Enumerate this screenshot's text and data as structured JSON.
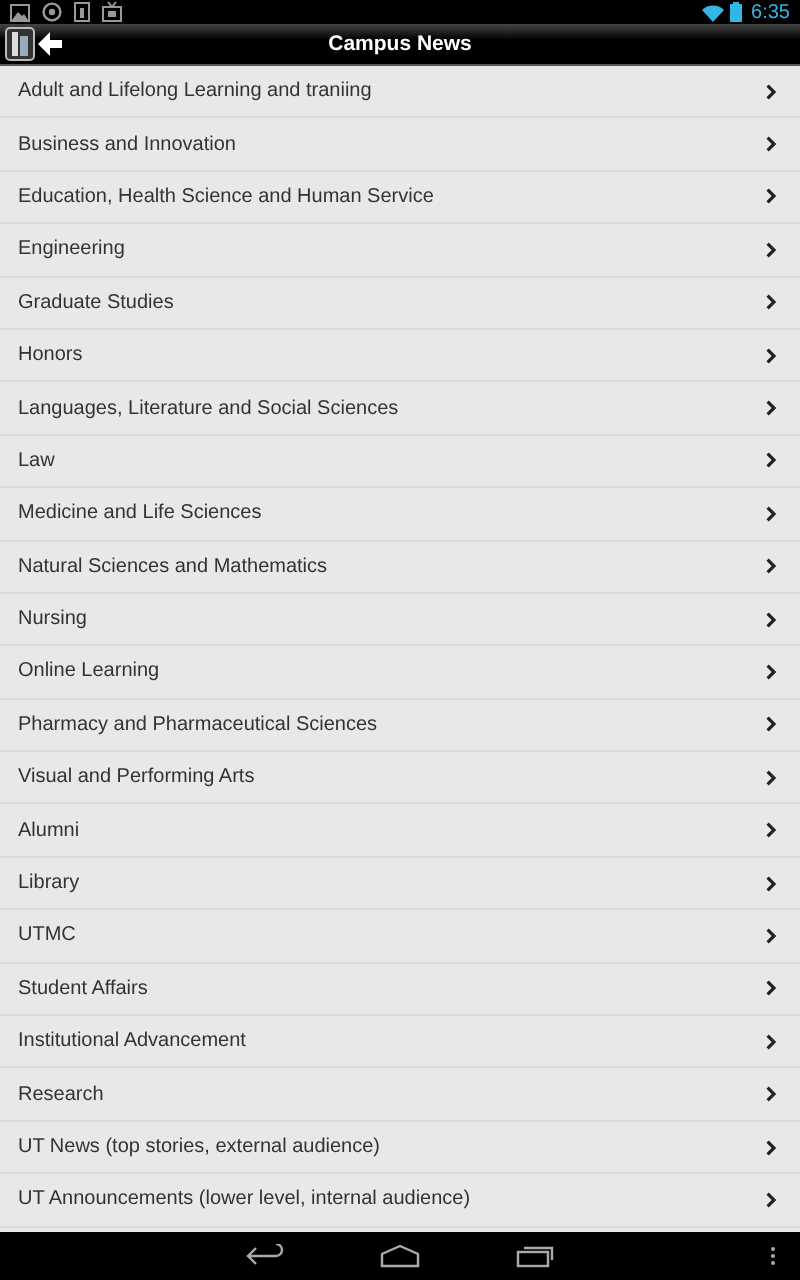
{
  "status_bar": {
    "time": "6:35"
  },
  "action_bar": {
    "title": "Campus News"
  },
  "items": [
    "Adult and Lifelong Learning and traniing",
    "Business and Innovation",
    "Education, Health Science and Human Service",
    "Engineering",
    "Graduate Studies",
    "Honors",
    "Languages, Literature and Social Sciences",
    "Law",
    "Medicine and Life Sciences",
    "Natural Sciences and Mathematics",
    "Nursing",
    "Online Learning",
    "Pharmacy and Pharmaceutical Sciences",
    "Visual and Performing Arts",
    "Alumni",
    "Library",
    "UTMC",
    "Student Affairs",
    "Institutional Advancement",
    "Research",
    "UT News (top stories, external audience)",
    "UT Announcements (lower level, internal audience)"
  ]
}
